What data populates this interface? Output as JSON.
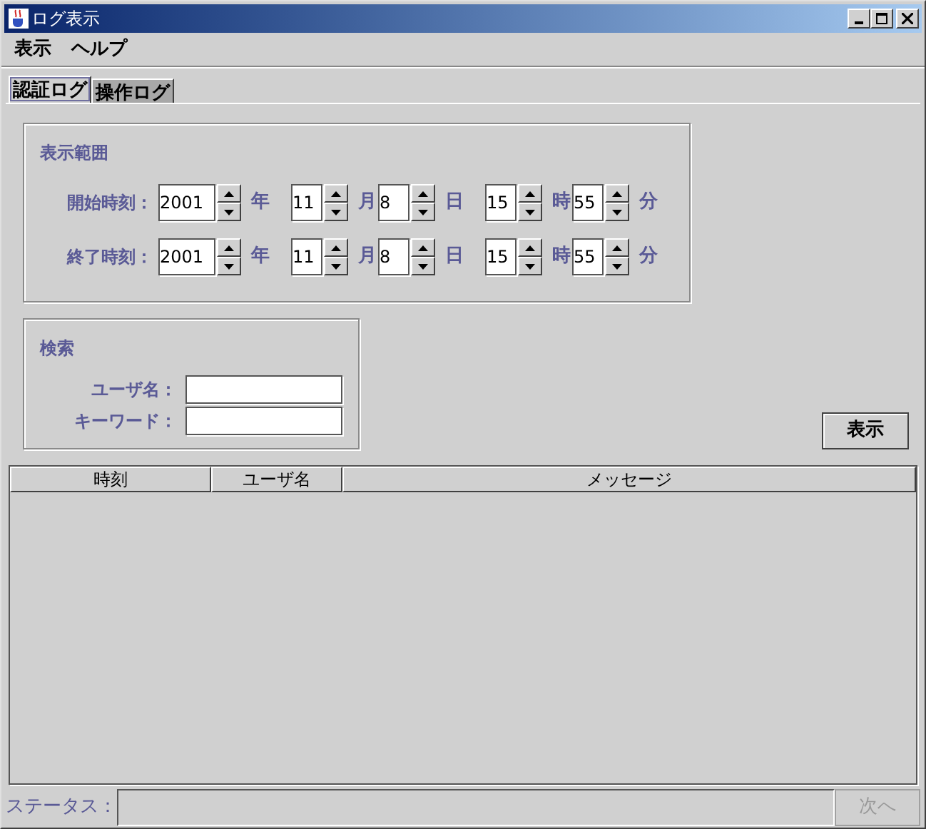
{
  "window": {
    "title": "ログ表示"
  },
  "menu": [
    "表示",
    "ヘルプ"
  ],
  "tabs": [
    {
      "label": "認証ログ",
      "selected": true
    },
    {
      "label": "操作ログ",
      "selected": false
    }
  ],
  "range": {
    "title": "表示範囲",
    "rows": [
      {
        "label": "開始時刻：",
        "fields": [
          {
            "value": "2001",
            "unit": "年"
          },
          {
            "value": "11",
            "unit": "月"
          },
          {
            "value": "8",
            "unit": "日"
          },
          {
            "value": "15",
            "unit": "時"
          },
          {
            "value": "55",
            "unit": "分"
          }
        ]
      },
      {
        "label": "終了時刻：",
        "fields": [
          {
            "value": "2001",
            "unit": "年"
          },
          {
            "value": "11",
            "unit": "月"
          },
          {
            "value": "8",
            "unit": "日"
          },
          {
            "value": "15",
            "unit": "時"
          },
          {
            "value": "55",
            "unit": "分"
          }
        ]
      }
    ]
  },
  "search": {
    "title": "検索",
    "fields": [
      {
        "label": "ユーザ名："
      },
      {
        "label": "キーワード："
      }
    ]
  },
  "show_button": "表示",
  "table": {
    "columns": [
      "時刻",
      "ユーザ名",
      "メッセージ"
    ]
  },
  "status_bar": {
    "label": "ステータス：",
    "next_button": {
      "label": "次へ",
      "disabled": true
    }
  }
}
